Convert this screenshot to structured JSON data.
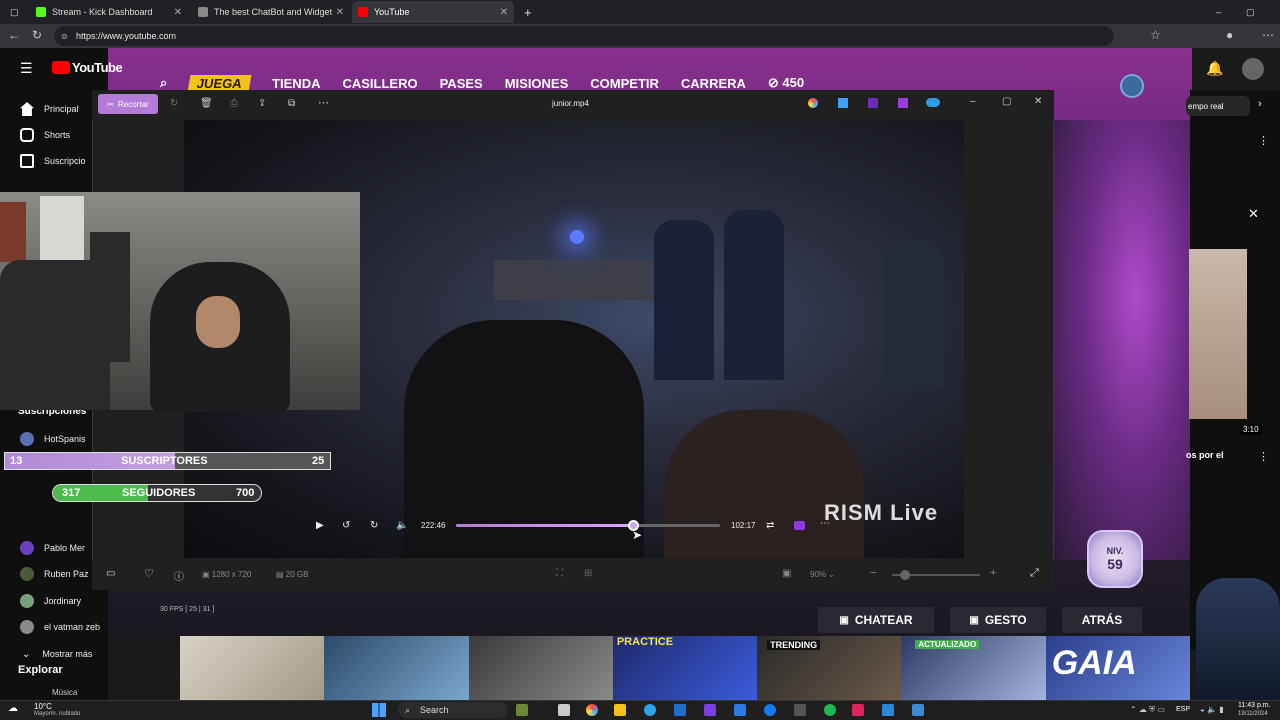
{
  "browser": {
    "tabs": [
      {
        "title": "Stream - Kick Dashboard",
        "color": "#53fc18"
      },
      {
        "title": "The best ChatBot and Widgets fo",
        "color": "#8a8a8a"
      },
      {
        "title": "YouTube",
        "color": "#ff0000"
      }
    ],
    "url": "https://www.youtube.com"
  },
  "youtube": {
    "logo": "YouTube",
    "sidebar": {
      "items": [
        "Principal",
        "Shorts",
        "Suscripcio"
      ],
      "subscriptions_heading": "Suscripciones",
      "subs": [
        "HotSpanis",
        "Pablo Mer",
        "Ruben Paz",
        "Jordinary",
        "el vatman zeb"
      ],
      "show_more": "Mostrar más",
      "explore": "Explorar",
      "music": "Música"
    },
    "right": {
      "chip": "empo real",
      "duration": "3:10",
      "caption": "os por el"
    }
  },
  "game": {
    "nav": [
      "JUEGA",
      "TIENDA",
      "CASILLERO",
      "PASES",
      "MISIONES",
      "COMPETIR",
      "CARRERA",
      "450"
    ],
    "level_label": "NIV.",
    "level": "59",
    "buttons": [
      "CHATEAR",
      "GESTO",
      "ATRÁS"
    ],
    "thumb_labels": [
      "PRACTICE",
      "TRENDING",
      "ACTUALIZADO",
      "GAIA"
    ]
  },
  "photos_app": {
    "title": "junior.mp4",
    "edit_button": "Recortar",
    "elapsed": "222:46",
    "remaining": "102:17",
    "progress": 0.67,
    "resolution": "1280 x 720",
    "size": "20 GB",
    "zoom": "90%",
    "fps": "30 FPS [ 25 | 31 ]",
    "watermark": "RISM Live"
  },
  "overlays": {
    "subs": {
      "current": "13",
      "label": "SUSCRIPTORES",
      "goal": "25",
      "fraction": 0.52
    },
    "followers": {
      "current": "317",
      "label": "SEGUIDORES",
      "goal": "700",
      "fraction": 0.45
    }
  },
  "taskbar": {
    "weather": "10°C",
    "weather_sub": "Mayorm. nublado",
    "search": "Search",
    "lang": "ESP",
    "time": "11:43 p.m.",
    "date": "19/11/2024"
  }
}
